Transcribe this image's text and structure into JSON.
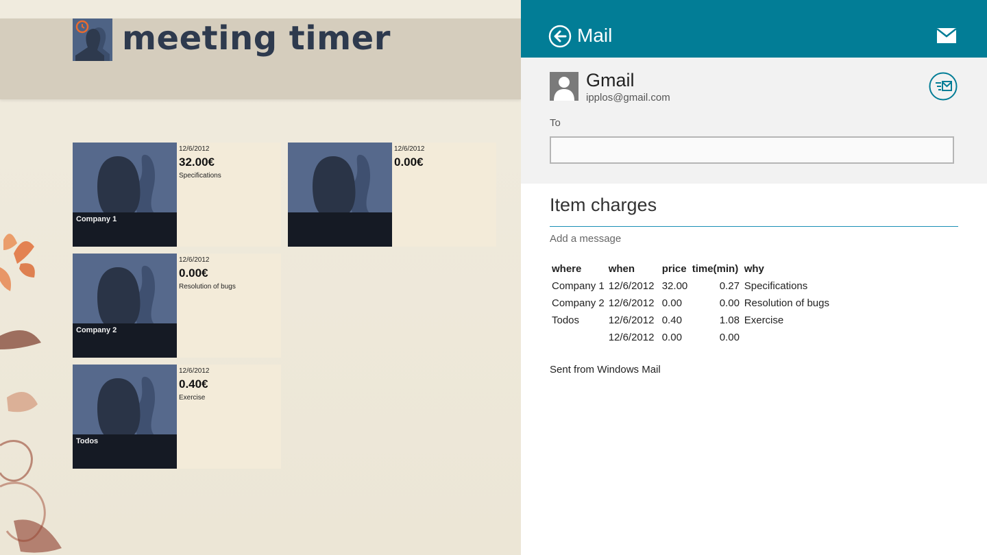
{
  "app": {
    "title": "meeting timer",
    "tiles": [
      {
        "company": "Company 1",
        "date": "12/6/2012",
        "amount": "32.00€",
        "description": "Specifications"
      },
      {
        "company": "",
        "date": "12/6/2012",
        "amount": "0.00€",
        "description": ""
      },
      {
        "company": "Company 2",
        "date": "12/6/2012",
        "amount": "0.00€",
        "description": "Resolution of bugs"
      },
      {
        "company": "Todos",
        "date": "12/6/2012",
        "amount": "0.40€",
        "description": "Exercise"
      }
    ]
  },
  "mail": {
    "title": "Mail",
    "account": {
      "name": "Gmail",
      "email": "ipplos@gmail.com"
    },
    "to_label": "To",
    "to_value": "",
    "subject": "Item charges",
    "message_placeholder": "Add a message",
    "table": {
      "headers": [
        "where",
        "when",
        "price",
        "time(min)",
        "why"
      ],
      "rows": [
        [
          "Company 1",
          "12/6/2012",
          "32.00",
          "0.27",
          "Specifications"
        ],
        [
          "Company 2",
          "12/6/2012",
          "0.00",
          "0.00",
          "Resolution of bugs"
        ],
        [
          "Todos",
          "12/6/2012",
          "0.40",
          "1.08",
          "Exercise"
        ],
        [
          "",
          "12/6/2012",
          "0.00",
          "0.00",
          ""
        ]
      ]
    },
    "signature": "Sent from Windows Mail"
  },
  "colors": {
    "mail_accent": "#027d96",
    "app_background": "#efe9db",
    "app_header": "#d5cdbd",
    "tile_image": "#56698c",
    "tile_info": "#f3ebd9"
  },
  "icons": {
    "back": "back-arrow-circle-icon",
    "envelope": "envelope-icon",
    "accounts": "accounts-mail-icon",
    "avatar": "person-silhouette-icon",
    "logo": "clock-people-icon"
  }
}
